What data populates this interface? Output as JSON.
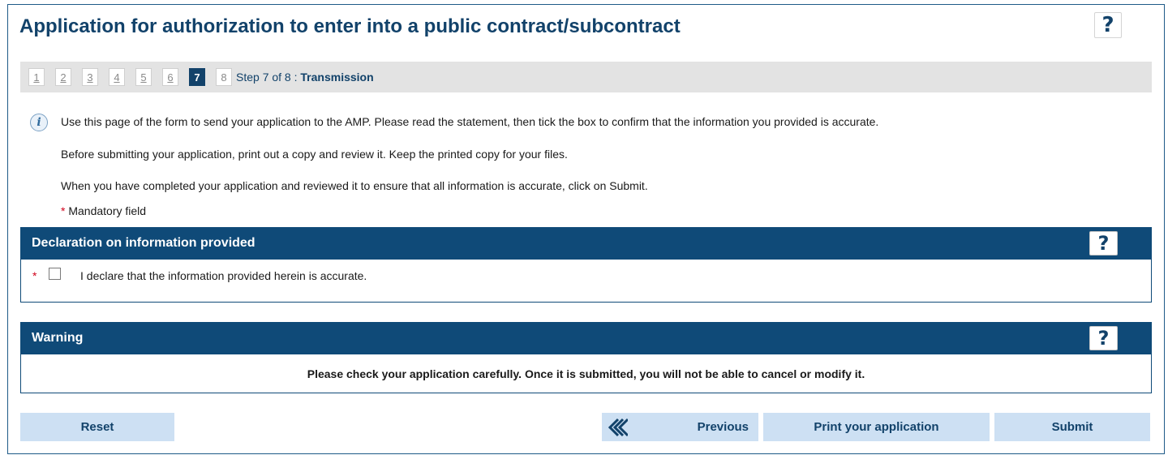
{
  "title": "Application for authorization to enter into a public contract/subcontract",
  "help_label": "?",
  "stepper": {
    "steps": [
      "1",
      "2",
      "3",
      "4",
      "5",
      "6",
      "7",
      "8"
    ],
    "current": "7",
    "label_prefix": "Step 7 of 8 : ",
    "label_name": "Transmission"
  },
  "info": {
    "icon": "info-icon",
    "icon_glyph": "i",
    "paragraph1": "Use this page of the form to send your application to the AMP. Please read the statement, then tick the box to confirm that the information you provided is accurate.",
    "paragraph2": "Before submitting your application, print out a copy and review it. Keep the printed copy for your files.",
    "paragraph3": "When you have completed your application and reviewed it to ensure that all information is accurate, click on Submit.",
    "mandatory_star": "*",
    "mandatory_label": "Mandatory field"
  },
  "declaration": {
    "header": "Declaration on information provided",
    "required_star": "*",
    "checked": false,
    "checkbox_label": "I declare that the information provided herein is accurate."
  },
  "warning": {
    "header": "Warning",
    "text": "Please check your application carefully. Once it is submitted, you will not be able to cancel or modify it."
  },
  "buttons": {
    "reset": "Reset",
    "previous": "Previous",
    "previous_icon": "double-chevron-left-icon",
    "print": "Print your application",
    "submit": "Submit"
  },
  "colors": {
    "brand_navy": "#0f4a78",
    "title_navy": "#12426a",
    "button_bg": "#cde0f3",
    "required_red": "#d0021b",
    "stepbar_bg": "#e3e3e3"
  }
}
